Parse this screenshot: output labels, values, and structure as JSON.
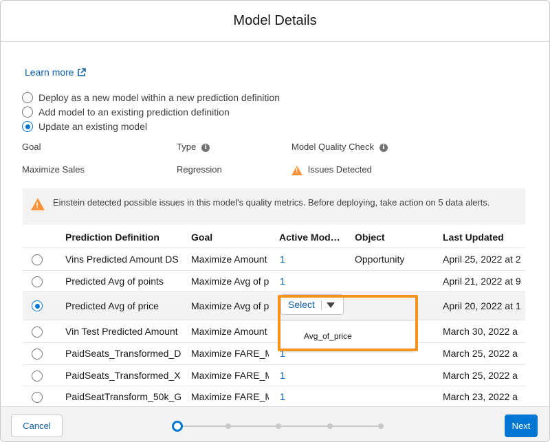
{
  "modal": {
    "title": "Model Details"
  },
  "learn_more": {
    "label": "Learn more",
    "icon": "external-link-icon"
  },
  "options": [
    {
      "label": "Deploy as a new model within a new prediction definition",
      "checked": false
    },
    {
      "label": "Add model to an existing prediction definition",
      "checked": false
    },
    {
      "label": "Update an existing model",
      "checked": true
    }
  ],
  "summary": {
    "goal_label": "Goal",
    "goal_value": "Maximize Sales",
    "type_label": "Type",
    "type_value": "Regression",
    "quality_label": "Model Quality Check",
    "quality_value": "Issues Detected"
  },
  "banner": {
    "text": "Einstein detected possible issues in this model's quality metrics. Before deploying, take action on 5 data alerts."
  },
  "table": {
    "headers": [
      "Prediction Definition",
      "Goal",
      "Active Mod…",
      "Object",
      "Last Updated"
    ],
    "rows": [
      {
        "definition": "Vins Predicted Amount DS",
        "goal": "Maximize Amount",
        "active": "1",
        "object": "Opportunity",
        "updated": "April 25, 2022 at 2",
        "selected": false
      },
      {
        "definition": "Predicted Avg of points",
        "goal": "Maximize Avg of p",
        "active": "1",
        "object": "",
        "updated": "April 21, 2022 at 9",
        "selected": false
      },
      {
        "definition": "Predicted Avg of price",
        "goal": "Maximize Avg of p",
        "active": "",
        "object": "",
        "updated": "April 20, 2022 at 1",
        "selected": true
      },
      {
        "definition": "Vin Test Predicted Amount",
        "goal": "Maximize Amount",
        "active": "",
        "object": "",
        "updated": "March 30, 2022 a",
        "selected": false
      },
      {
        "definition": "PaidSeats_Transformed_D",
        "goal": "Maximize FARE_M",
        "active": "1",
        "object": "",
        "updated": "March 25, 2022 a",
        "selected": false
      },
      {
        "definition": "PaidSeats_Transformed_X",
        "goal": "Maximize FARE_M",
        "active": "1",
        "object": "",
        "updated": "March 25, 2022 a",
        "selected": false
      },
      {
        "definition": "PaidSeatTransform_50k_G",
        "goal": "Maximize FARE_M",
        "active": "1",
        "object": "",
        "updated": "March 23, 2022 a",
        "selected": false
      }
    ]
  },
  "dropdown": {
    "label": "Select",
    "options": [
      "Avg_of_price"
    ]
  },
  "footer": {
    "cancel_label": "Cancel",
    "next_label": "Next",
    "steps_total": 5,
    "current_step": 1
  },
  "colors": {
    "brand": "#0176d3",
    "link": "#0b5cab",
    "warning": "#fe9339",
    "highlight": "#f7941d"
  }
}
